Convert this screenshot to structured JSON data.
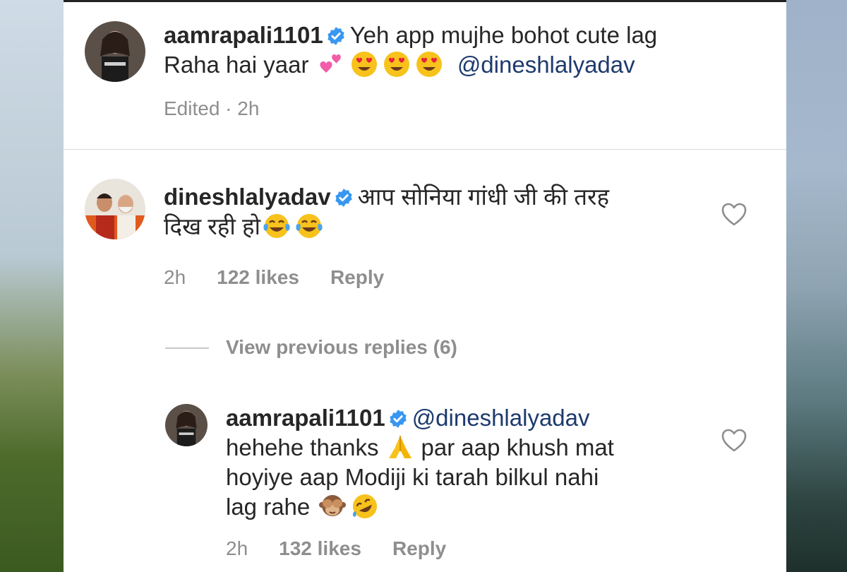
{
  "comments": [
    {
      "username": "aamrapali1101",
      "text_line1": "Yeh app mujhe bohot cute lag",
      "text_line2": "Raha hai yaar",
      "mention": "@dineshlalyadav",
      "emojis": [
        "two-hearts-emoji",
        "heart-eyes-emoji",
        "heart-eyes-emoji",
        "heart-eyes-emoji"
      ],
      "meta": "Edited · 2h"
    },
    {
      "username": "dineshlalyadav",
      "text_line1": "आप सोनिया गांधी जी की तरह",
      "text_line2": "दिख रही हो",
      "emojis": [
        "tears-of-joy-emoji",
        "tears-of-joy-emoji"
      ],
      "time": "2h",
      "likes": "122 likes",
      "reply": "Reply"
    }
  ],
  "view_previous_replies": "View previous replies (6)",
  "reply": {
    "username": "aamrapali1101",
    "mention": "@dineshlalyadav",
    "text_line1a": "hehehe thanks",
    "text_line1b": "par aap khush mat",
    "text_line2": "hoyiye aap Modiji ki tarah bilkul nahi",
    "text_line3": "lag rahe",
    "emojis": [
      "folded-hands-emoji",
      "see-no-evil-monkey-emoji",
      "rofl-emoji"
    ],
    "time": "2h",
    "likes": "132 likes",
    "reply_label": "Reply"
  },
  "colors": {
    "text": "#262626",
    "secondary": "#8e8e8e",
    "mention": "#1d3a6e",
    "verified": "#3897f0"
  }
}
